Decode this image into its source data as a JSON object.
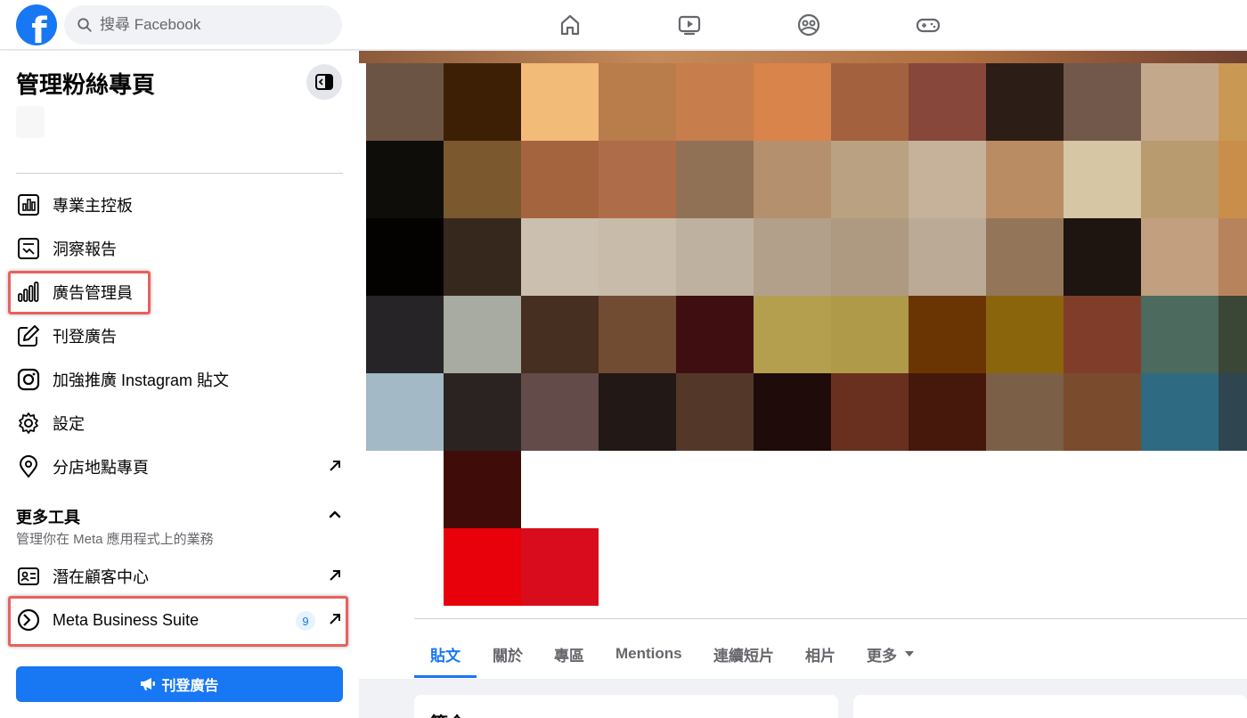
{
  "topbar": {
    "logo_letter": "f",
    "search_placeholder": "搜尋 Facebook",
    "nav_icons": [
      "home-icon",
      "video-icon",
      "groups-icon",
      "gaming-icon"
    ]
  },
  "sidebar": {
    "title": "管理粉絲專頁",
    "items": [
      {
        "label": "專業主控板",
        "icon": "dashboard-icon"
      },
      {
        "label": "洞察報告",
        "icon": "insights-icon"
      },
      {
        "label": "廣告管理員",
        "icon": "bar-chart-icon"
      },
      {
        "label": "刊登廣告",
        "icon": "edit-icon"
      },
      {
        "label": "加強推廣 Instagram 貼文",
        "icon": "instagram-icon"
      },
      {
        "label": "設定",
        "icon": "gear-icon"
      },
      {
        "label": "分店地點專頁",
        "icon": "location-icon"
      }
    ],
    "more_tools": {
      "title": "更多工具",
      "subtitle": "管理你在 Meta 應用程式上的業務",
      "items": [
        {
          "label": "潛在顧客中心",
          "icon": "contact-card-icon"
        },
        {
          "label": "Meta Business Suite",
          "icon": "meta-business-icon",
          "badge": "9"
        }
      ]
    },
    "cta_label": "刊登廣告"
  },
  "main": {
    "tabs": [
      "貼文",
      "關於",
      "專區",
      "Mentions",
      "連續短片",
      "相片",
      "更多"
    ],
    "active_tab": "貼文",
    "card_title": "簡介"
  },
  "colors": {
    "accent": "#1877f2",
    "highlight": "#e8615e",
    "mosaic": [
      [
        "#6b5443",
        "#3d1f05",
        "#f3bb78",
        "#b97c4b",
        "#c87d4c",
        "#d8844a",
        "#a3623d",
        "#87473a",
        "#2c1d16",
        "#72574b",
        "#c4a88c",
        "#c99954"
      ],
      [
        "#0f0d09",
        "#7b582d",
        "#a4643e",
        "#ae6d48",
        "#917156",
        "#b5906f",
        "#b9a181",
        "#c6b19b",
        "#ba8c63",
        "#d7c6a4",
        "#b99b70",
        "#c98f4a"
      ],
      [
        "#030201",
        "#37281d",
        "#cbbfaf",
        "#c8bba9",
        "#beb19f",
        "#b3a08a",
        "#ad9a80",
        "#bbaa96",
        "#93765a",
        "#1e1410",
        "#c29f7e",
        "#b7835c"
      ],
      [
        "#272427",
        "#a7aba1",
        "#462f21",
        "#724b33",
        "#3f0e11",
        "#b49f4f",
        "#ae9a49",
        "#6b3403",
        "#8b650b",
        "#803e2a",
        "#4c6a5e",
        "#3a4636"
      ],
      [
        "#a3b9c6",
        "#2b2321",
        "#624b49",
        "#221816",
        "#533829",
        "#1e0b0a",
        "#6a301f",
        "#45180b",
        "#7b6047",
        "#7a4b2c",
        "#2e6b82",
        "#2f4651"
      ],
      [
        null,
        "#400c0a",
        null,
        null,
        null,
        null,
        null,
        null,
        null,
        null,
        null,
        null
      ],
      [
        null,
        "#e8000b",
        "#d80c1c",
        null,
        null,
        null,
        null,
        null,
        null,
        null,
        null,
        null
      ]
    ]
  }
}
